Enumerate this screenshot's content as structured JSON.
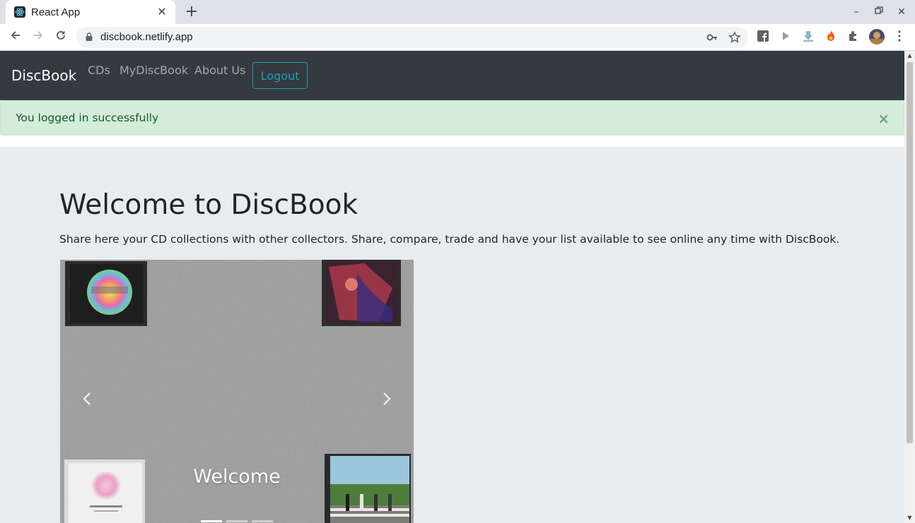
{
  "browser": {
    "tab_title": "React App",
    "url": "discbook.netlify.app"
  },
  "navbar": {
    "brand": "DiscBook",
    "links": [
      "CDs",
      "MyDiscBook",
      "About Us"
    ],
    "logout_label": "Logout"
  },
  "alert": {
    "message": "You logged in successfully",
    "close_symbol": "×"
  },
  "main": {
    "heading": "Welcome to DiscBook",
    "lead": "Share here your CD collections with other collectors. Share, compare, trade and have your list available to see online any time with DiscBook."
  },
  "carousel": {
    "caption": "Welcome",
    "indicator_count": 3,
    "active_index": 0
  },
  "colors": {
    "navbar_bg": "#343a40",
    "jumbotron_bg": "#e9ecef",
    "alert_bg": "#d4edda",
    "alert_text": "#155724",
    "info": "#17a2b8"
  }
}
